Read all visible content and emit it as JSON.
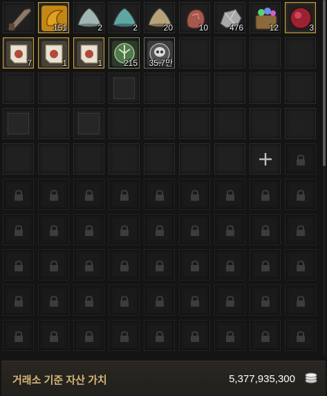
{
  "inventory": {
    "items": [
      {
        "name": "rifle-item-icon",
        "qty": "",
        "frame": "plain",
        "color": "#8a7a6a"
      },
      {
        "name": "gold-scroll-item-icon",
        "qty": "151",
        "frame": "gold",
        "color": "#e0a020"
      },
      {
        "name": "silver-shell-item-icon",
        "qty": "2",
        "frame": "plain",
        "color": "#9fb6b2"
      },
      {
        "name": "teal-shell-item-icon",
        "qty": "2",
        "frame": "plain",
        "color": "#5fa7a2"
      },
      {
        "name": "tan-shell-item-icon",
        "qty": "20",
        "frame": "plain",
        "color": "#b7a27a"
      },
      {
        "name": "red-ore-item-icon",
        "qty": "10",
        "frame": "plain",
        "color": "#a5584d"
      },
      {
        "name": "silver-ore-item-icon",
        "qty": "476",
        "frame": "plain",
        "color": "#a9a9a9"
      },
      {
        "name": "gem-pouch-item-icon",
        "qty": "12",
        "frame": "plain",
        "color": "#8a6a3a"
      },
      {
        "name": "crimson-orb-item-icon",
        "qty": "3",
        "frame": "gold",
        "color": "#9a2233"
      },
      {
        "name": "scroll-item-icon",
        "qty": "7",
        "frame": "gold",
        "color": "#e8e2d4"
      },
      {
        "name": "scroll-item-icon",
        "qty": "1",
        "frame": "gold",
        "color": "#e8e2d4"
      },
      {
        "name": "scroll-item-icon",
        "qty": "1",
        "frame": "gold",
        "color": "#e8e2d4"
      },
      {
        "name": "green-emblem-item-icon",
        "qty": "215",
        "frame": "green",
        "color": "#4f7a4f"
      },
      {
        "name": "skull-emblem-item-icon",
        "qty": "35.7만",
        "frame": "gray",
        "color": "#d8d8d8"
      }
    ]
  },
  "footer": {
    "label": "거래소 기준 자산 가치",
    "value": "5,377,935,300",
    "icon": "silver-coin-stack-icon"
  },
  "colors": {
    "gold_frame": "#d4a53a",
    "footer_label": "#d6b77a",
    "slot_bg": "#202020"
  }
}
